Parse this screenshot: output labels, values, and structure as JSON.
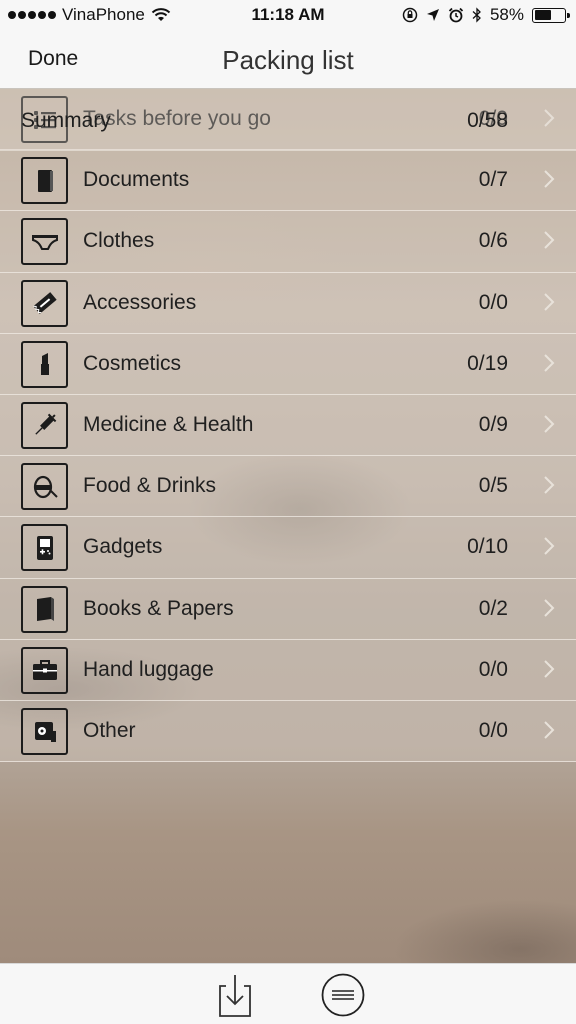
{
  "status": {
    "carrier": "VinaPhone",
    "time": "11:18 AM",
    "battery": "58%",
    "battery_level": 0.58
  },
  "nav": {
    "done_label": "Done",
    "title": "Packing list"
  },
  "categories": [
    {
      "label": "Tasks before you go",
      "count": "0/0",
      "icon": "checklist-icon"
    },
    {
      "label": "Documents",
      "count": "0/7",
      "icon": "document-icon"
    },
    {
      "label": "Clothes",
      "count": "0/6",
      "icon": "underwear-icon"
    },
    {
      "label": "Accessories",
      "count": "0/0",
      "icon": "razor-blade-icon"
    },
    {
      "label": "Cosmetics",
      "count": "0/19",
      "icon": "lipstick-icon"
    },
    {
      "label": "Medicine & Health",
      "count": "0/9",
      "icon": "syringe-icon"
    },
    {
      "label": "Food & Drinks",
      "count": "0/5",
      "icon": "food-icon"
    },
    {
      "label": "Gadgets",
      "count": "0/10",
      "icon": "gameboy-icon"
    },
    {
      "label": "Books & Papers",
      "count": "0/2",
      "icon": "book-icon"
    },
    {
      "label": "Hand luggage",
      "count": "0/0",
      "icon": "briefcase-icon"
    },
    {
      "label": "Other",
      "count": "0/0",
      "icon": "toilet-paper-icon"
    }
  ],
  "summary": {
    "label": "Summary",
    "count": "0/58"
  },
  "toolbar": {
    "download_icon": "download-icon",
    "menu_icon": "menu-icon"
  }
}
